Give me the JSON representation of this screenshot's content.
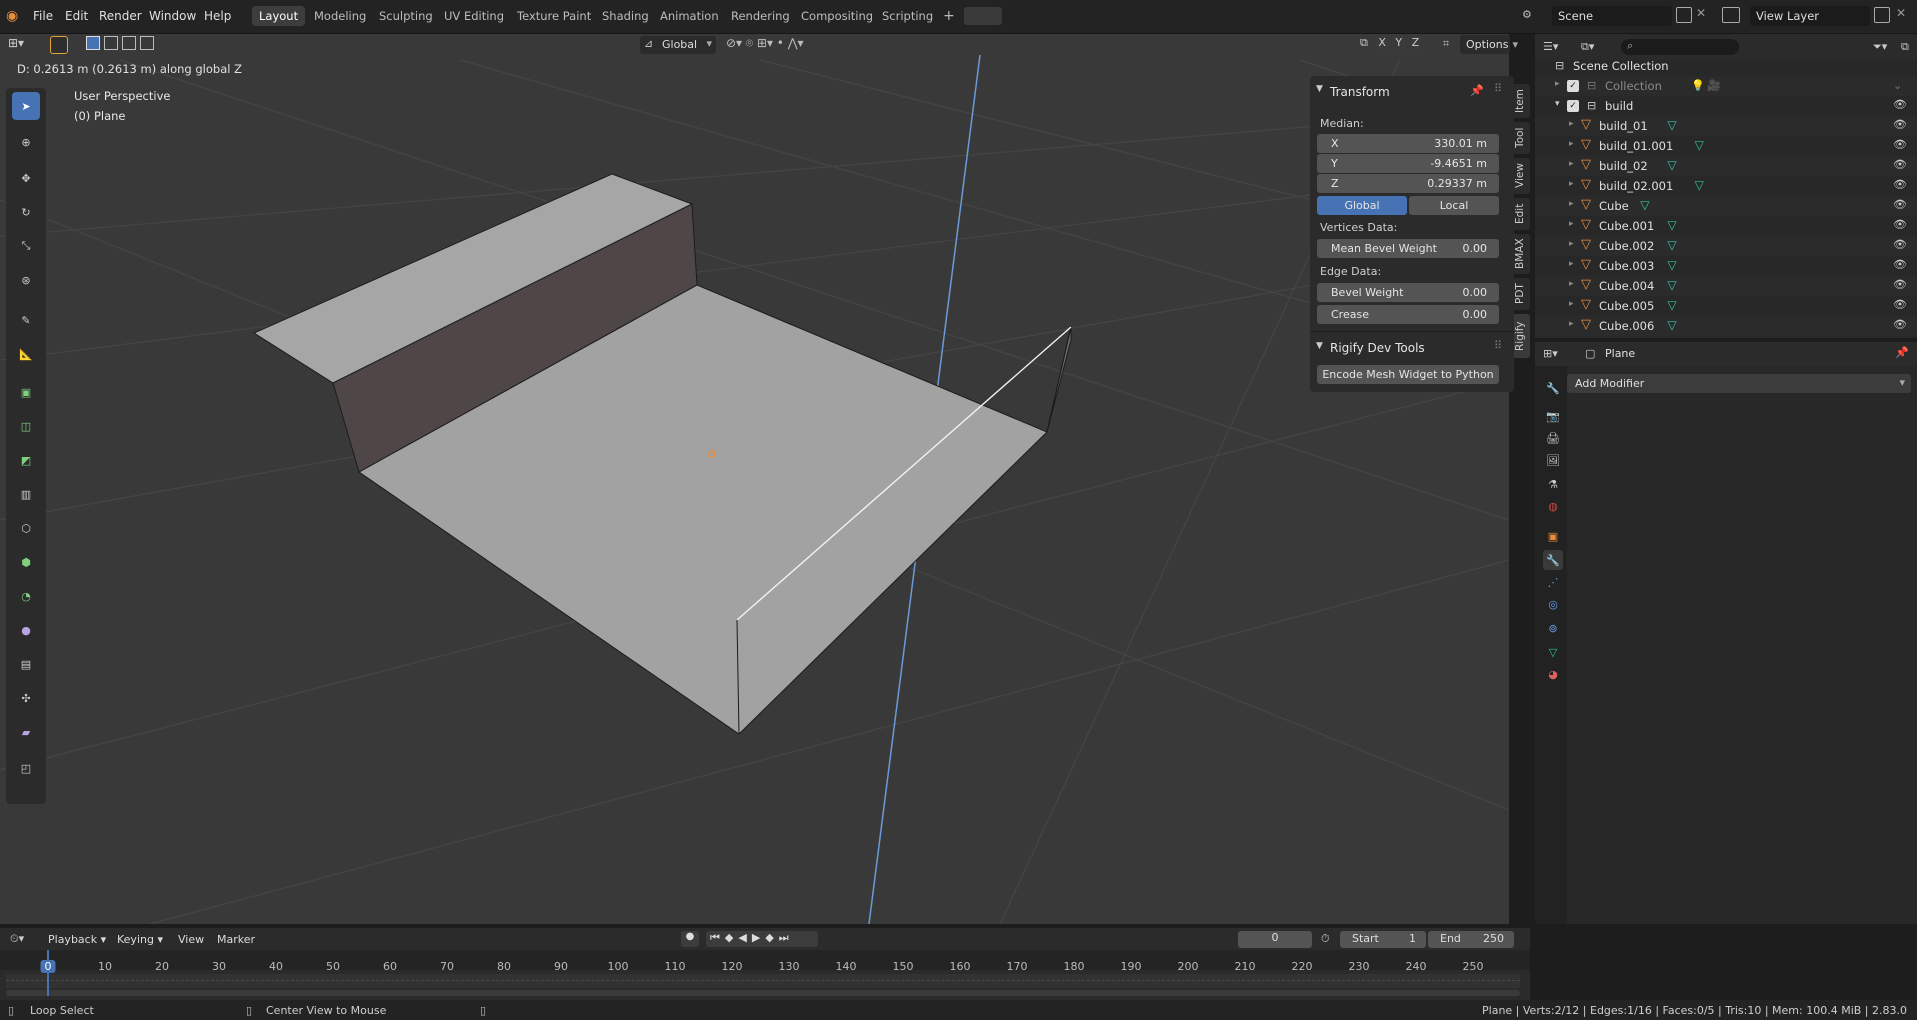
{
  "menu": {
    "items": [
      "File",
      "Edit",
      "Render",
      "Window",
      "Help"
    ]
  },
  "workspaces": [
    "Layout",
    "Modeling",
    "Sculpting",
    "UV Editing",
    "Texture Paint",
    "Shading",
    "Animation",
    "Rendering",
    "Compositing",
    "Scripting"
  ],
  "active_workspace": "Layout",
  "scene": {
    "name": "Scene",
    "view_layer": "View Layer"
  },
  "viewport": {
    "status_text": "D: 0.2613 m (0.2613 m) along global Z",
    "perspective": "User Perspective",
    "object": "(0) Plane",
    "orientation": "Global",
    "axes": [
      "X",
      "Y",
      "Z"
    ],
    "options": "Options"
  },
  "npanel": {
    "transform_title": "Transform",
    "median_label": "Median:",
    "x_label": "X",
    "x_value": "330.01 m",
    "y_label": "Y",
    "y_value": "-9.4651 m",
    "z_label": "Z",
    "z_value": "0.29337 m",
    "global": "Global",
    "local": "Local",
    "vertices_data": "Vertices Data:",
    "mean_bevel_weight": "Mean Bevel Weight",
    "mean_bevel_value": "0.00",
    "edge_data": "Edge Data:",
    "bevel_weight": "Bevel Weight",
    "bevel_value": "0.00",
    "crease": "Crease",
    "crease_value": "0.00",
    "rigify_title": "Rigify Dev Tools",
    "encode_button": "Encode Mesh Widget to Python",
    "tabs": [
      "Item",
      "Tool",
      "View",
      "Edit",
      "BMAX",
      "PDT",
      "Rigify"
    ]
  },
  "outliner": {
    "root": "Scene Collection",
    "collection": "Collection",
    "build": "build",
    "items": [
      "build_01",
      "build_01.001",
      "build_02",
      "build_02.001",
      "Cube",
      "Cube.001",
      "Cube.002",
      "Cube.003",
      "Cube.004",
      "Cube.005",
      "Cube.006"
    ]
  },
  "properties": {
    "object": "Plane",
    "add_modifier": "Add Modifier"
  },
  "timeline": {
    "menus": [
      "Playback",
      "Keying",
      "View",
      "Marker"
    ],
    "current_frame": "0",
    "start_label": "Start",
    "start": "1",
    "end_label": "End",
    "end": "250",
    "ticks": [
      "0",
      "10",
      "20",
      "30",
      "40",
      "50",
      "60",
      "70",
      "80",
      "90",
      "100",
      "110",
      "120",
      "130",
      "140",
      "150",
      "160",
      "170",
      "180",
      "190",
      "200",
      "210",
      "220",
      "230",
      "240",
      "250"
    ]
  },
  "status": {
    "left1": "Loop Select",
    "left2": "Center View to Mouse",
    "right": "Plane | Verts:2/12 | Edges:1/16 | Faces:0/5 | Tris:10 | Mem: 100.4 MiB | 2.83.0"
  },
  "colors": {
    "accent": "#4772b3",
    "object_orange": "#e88c3c",
    "mesh_green": "#2ec4a0"
  }
}
